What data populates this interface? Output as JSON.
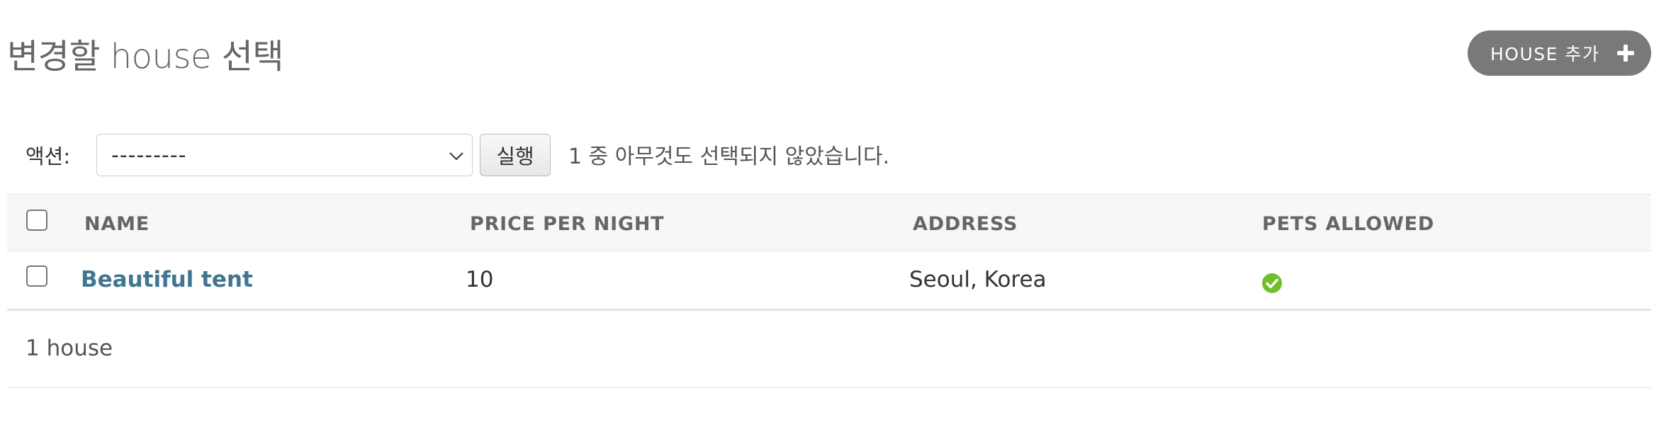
{
  "page": {
    "title": "변경할 house 선택",
    "add_button_label": "HOUSE 추가"
  },
  "actions": {
    "label": "액션:",
    "select_value": "---------",
    "run_label": "실행",
    "status": "1 중 아무것도 선택되지 않았습니다."
  },
  "table": {
    "headers": {
      "name": "NAME",
      "price": "PRICE PER NIGHT",
      "address": "ADDRESS",
      "pets": "PETS ALLOWED"
    },
    "rows": [
      {
        "name": "Beautiful tent",
        "price": "10",
        "address": "Seoul, Korea",
        "pets_allowed": true,
        "pets_icon": "check-circle-icon"
      }
    ]
  },
  "paginator": {
    "count_text": "1 house"
  },
  "colors": {
    "link": "#417690",
    "add_button_bg": "#797979",
    "check_green": "#70bf2b"
  }
}
